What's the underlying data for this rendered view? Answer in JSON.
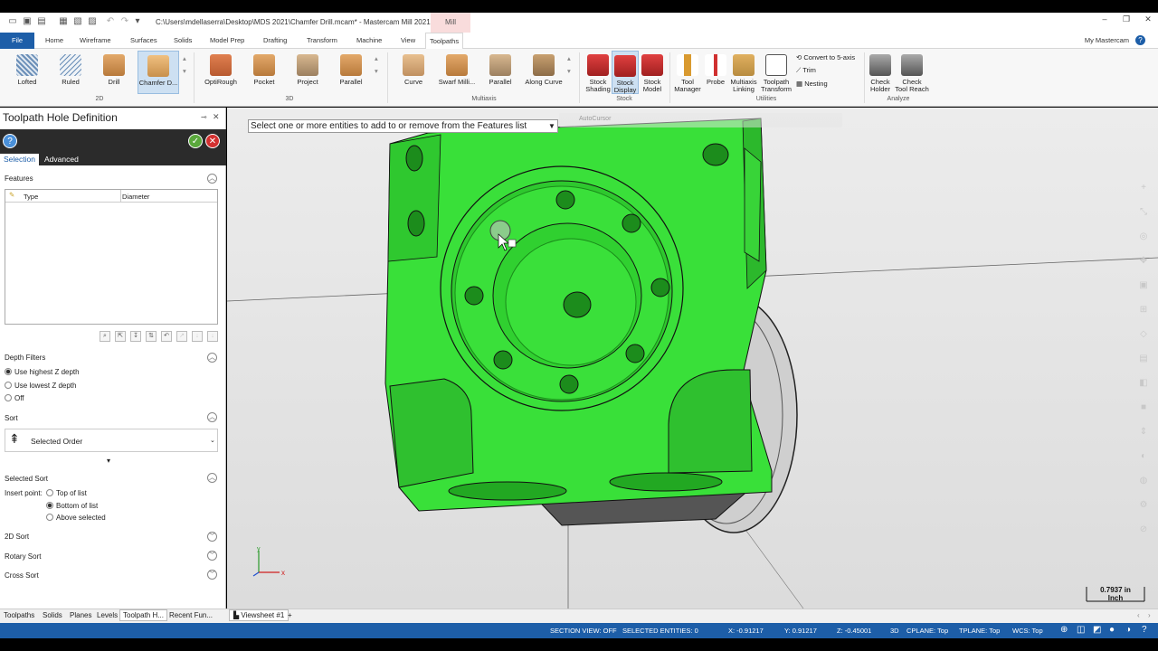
{
  "window": {
    "title": "C:\\Users\\mdellaserra\\Desktop\\MDS 2021\\Chamfer Drill.mcam* - Mastercam Mill 2021",
    "context_tab": "Mill"
  },
  "menu": {
    "file": "File",
    "tabs": [
      "Home",
      "Wireframe",
      "Surfaces",
      "Solids",
      "Model Prep",
      "Drafting",
      "Transform",
      "Machine",
      "View",
      "Toolpaths"
    ],
    "my_mastercam": "My Mastercam"
  },
  "ribbon": {
    "g2d": {
      "label": "2D",
      "buttons": [
        "Lofted",
        "Ruled",
        "Drill",
        "Chamfer D..."
      ]
    },
    "g3d": {
      "label": "3D",
      "buttons": [
        "OptiRough",
        "Pocket",
        "Project",
        "Parallel"
      ]
    },
    "gmulti": {
      "label": "Multiaxis",
      "buttons": [
        "Curve",
        "Swarf Milli...",
        "Parallel",
        "Along Curve"
      ]
    },
    "gstock": {
      "label": "Stock",
      "b1a": "Stock",
      "b1b": "Shading",
      "b2a": "Stock",
      "b2b": "Display",
      "b3a": "Stock",
      "b3b": "Model"
    },
    "gutil": {
      "label": "Utilities",
      "tm_a": "Tool",
      "tm_b": "Manager",
      "probe": "Probe",
      "ml_a": "Multiaxis",
      "ml_b": "Linking",
      "tt_a": "Toolpath",
      "tt_b": "Transform",
      "convert": "Convert to 5-axis",
      "trim": "Trim",
      "nesting": "Nesting"
    },
    "ganalyze": {
      "label": "Analyze",
      "ch_a": "Check",
      "ch_b": "Holder",
      "cr_a": "Check",
      "cr_b": "Tool Reach"
    }
  },
  "panel": {
    "title": "Toolpath Hole Definition",
    "tabs": {
      "selection": "Selection",
      "advanced": "Advanced"
    },
    "features": {
      "label": "Features",
      "col_type": "Type",
      "col_diameter": "Diameter"
    },
    "depth": {
      "label": "Depth Filters",
      "opts": [
        "Use highest Z depth",
        "Use lowest Z depth",
        "Off"
      ],
      "selected": 0
    },
    "sort": {
      "label": "Sort",
      "value": "Selected Order"
    },
    "selected_sort": {
      "label": "Selected Sort",
      "insert_point": "Insert point:",
      "opts": [
        "Top of list",
        "Bottom of list",
        "Above selected"
      ],
      "selected": 1
    },
    "collapsed": [
      "2D Sort",
      "Rotary Sort",
      "Cross Sort"
    ]
  },
  "viewport": {
    "prompt": "Select one or more entities to add to or remove from the Features list",
    "autocursor": "AutoCursor",
    "scale_value": "0.7937 in",
    "scale_unit": "Inch",
    "axis_x": "x",
    "axis_y": "y"
  },
  "bottom_tabs": {
    "left": [
      "Toolpaths",
      "Solids",
      "Planes",
      "Levels",
      "Toolpath H...",
      "Recent Fun..."
    ],
    "viewsheet": "Viewsheet #1",
    "plus": "+"
  },
  "status": {
    "section_view": "SECTION VIEW: OFF",
    "selected": "SELECTED ENTITIES: 0",
    "x": "X:  -0.91217",
    "y": "Y:  0.91217",
    "z": "Z:  -0.45001",
    "mode": "3D",
    "cplane": "CPLANE: Top",
    "tplane": "TPLANE: Top",
    "wcs": "WCS: Top"
  },
  "colors": {
    "accent": "#1d5ea8",
    "part_green": "#39e039",
    "panel_dark": "#2b2b2b"
  }
}
